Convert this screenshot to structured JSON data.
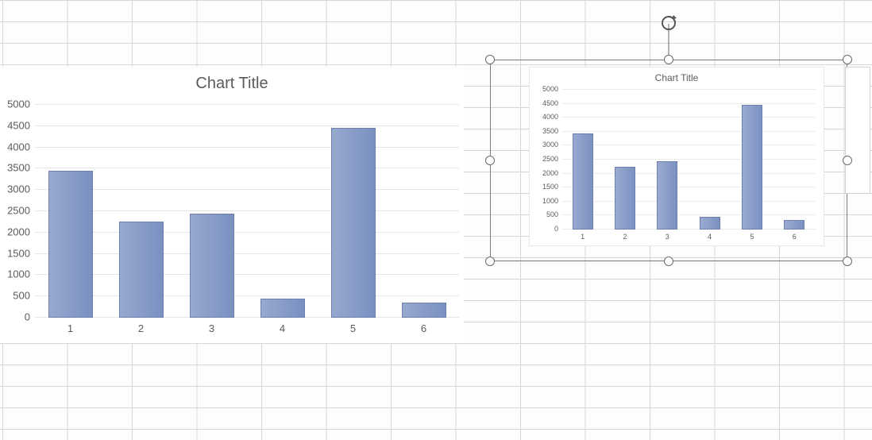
{
  "chart_data": [
    {
      "type": "bar",
      "title": "Chart Title",
      "categories": [
        "1",
        "2",
        "3",
        "4",
        "5",
        "6"
      ],
      "values": [
        3450,
        2250,
        2450,
        450,
        4450,
        350
      ],
      "ylim": [
        0,
        5000
      ],
      "ystep": 500,
      "yticks": [
        "0",
        "500",
        "1000",
        "1500",
        "2000",
        "2500",
        "3000",
        "3500",
        "4000",
        "4500",
        "5000"
      ]
    },
    {
      "type": "bar",
      "title": "Chart Title",
      "categories": [
        "1",
        "2",
        "3",
        "4",
        "5",
        "6"
      ],
      "values": [
        3450,
        2250,
        2450,
        450,
        4450,
        350
      ],
      "ylim": [
        0,
        5000
      ],
      "ystep": 500,
      "yticks": [
        "0",
        "500",
        "1000",
        "1500",
        "2000",
        "2500",
        "3000",
        "3500",
        "4000",
        "4500",
        "5000"
      ]
    }
  ],
  "colors": {
    "bar_fill": "#8496c2",
    "grid": "#e5e5e5",
    "text": "#5b5b5b",
    "selection_border": "#7a7a7a"
  }
}
